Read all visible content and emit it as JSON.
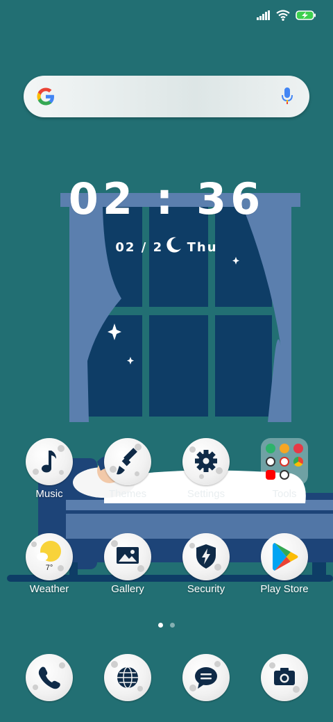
{
  "status_bar": {
    "signal_icon": "signal-bars-icon",
    "wifi_icon": "wifi-icon",
    "battery_icon": "battery-charging-icon",
    "battery_color": "#3ccf4e"
  },
  "search": {
    "logo": "google-g-logo",
    "mic_icon": "microphone-icon"
  },
  "clock": {
    "time": "02 : 36",
    "date": "02 / 2",
    "weekday": "Thu"
  },
  "apps_row1": [
    {
      "label": "Music",
      "icon": "music-note-icon"
    },
    {
      "label": "Themes",
      "icon": "paintbrush-icon"
    },
    {
      "label": "Settings",
      "icon": "gear-icon"
    },
    {
      "label": "Tools",
      "icon": "folder-icon"
    }
  ],
  "apps_row2": [
    {
      "label": "Weather",
      "icon": "weather-sun-cloud-icon",
      "temp": "7°"
    },
    {
      "label": "Gallery",
      "icon": "image-icon"
    },
    {
      "label": "Security",
      "icon": "shield-bolt-icon"
    },
    {
      "label": "Play Store",
      "icon": "play-store-icon"
    }
  ],
  "dock": [
    {
      "icon": "phone-icon"
    },
    {
      "icon": "globe-icon"
    },
    {
      "icon": "message-bubble-icon"
    },
    {
      "icon": "camera-icon"
    }
  ],
  "page_indicator": {
    "count": 2,
    "active": 1
  },
  "colors": {
    "background": "#226f73",
    "window_sky": "#0e3d66",
    "curtain": "#5b7fae",
    "bed_blue": "#1d4478"
  }
}
